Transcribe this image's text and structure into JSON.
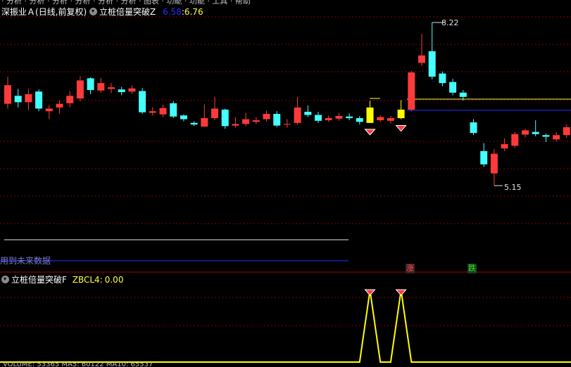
{
  "main_panel": {
    "stock_name": "深振业Ａ",
    "period": "(日线,前复权)",
    "indicator": "立桩倍量突破Z",
    "value1": "6.58",
    "separator": ":",
    "value2": "6.76",
    "value1_color": "#2b2bff",
    "value2_color": "#ffff4b",
    "high_label": "8.22",
    "low_label": "5.15",
    "future_data_warning": "用到未来数据",
    "tag_up": "涨",
    "tag_down": "跌"
  },
  "sub_panel": {
    "indicator": "立桩倍量突破F",
    "field": "ZBCL4",
    "separator": ":",
    "value": "0.00",
    "field_color": "#ffff4b"
  },
  "colors": {
    "up": "#ff3a3a",
    "down": "#44ffff",
    "signal": "#ffff00",
    "grid": "#8b0000",
    "panel_border": "#aa0000"
  },
  "chart_data": {
    "type": "candlestick",
    "price_high": 8.22,
    "price_low": 5.15,
    "candles": [
      {
        "o": 6.69,
        "c": 7.04,
        "h": 7.2,
        "l": 6.6
      },
      {
        "o": 6.84,
        "c": 6.72,
        "h": 6.97,
        "l": 6.62
      },
      {
        "o": 6.72,
        "c": 6.87,
        "h": 6.97,
        "l": 6.57
      },
      {
        "o": 6.92,
        "c": 6.6,
        "h": 6.96,
        "l": 6.55
      },
      {
        "o": 6.55,
        "c": 6.6,
        "h": 6.66,
        "l": 6.4
      },
      {
        "o": 6.62,
        "c": 6.69,
        "h": 6.75,
        "l": 6.5
      },
      {
        "o": 6.7,
        "c": 6.84,
        "h": 6.93,
        "l": 6.62
      },
      {
        "o": 6.79,
        "c": 7.13,
        "h": 7.21,
        "l": 6.74
      },
      {
        "o": 7.17,
        "c": 6.95,
        "h": 7.19,
        "l": 6.87
      },
      {
        "o": 6.94,
        "c": 7.08,
        "h": 7.18,
        "l": 6.9
      },
      {
        "o": 6.97,
        "c": 7.0,
        "h": 7.08,
        "l": 6.89
      },
      {
        "o": 6.96,
        "c": 6.91,
        "h": 7.01,
        "l": 6.85
      },
      {
        "o": 6.92,
        "c": 6.98,
        "h": 7.04,
        "l": 6.87
      },
      {
        "o": 6.93,
        "c": 6.53,
        "h": 6.99,
        "l": 6.5
      },
      {
        "o": 6.52,
        "c": 6.55,
        "h": 6.63,
        "l": 6.47
      },
      {
        "o": 6.49,
        "c": 6.61,
        "h": 6.67,
        "l": 6.44
      },
      {
        "o": 6.7,
        "c": 6.45,
        "h": 6.74,
        "l": 6.42
      },
      {
        "o": 6.47,
        "c": 6.4,
        "h": 6.49,
        "l": 6.36
      },
      {
        "o": 6.33,
        "c": 6.3,
        "h": 6.36,
        "l": 6.27
      },
      {
        "o": 6.26,
        "c": 6.42,
        "h": 6.68,
        "l": 6.26
      },
      {
        "o": 6.42,
        "c": 6.6,
        "h": 6.82,
        "l": 6.38
      },
      {
        "o": 6.58,
        "c": 6.27,
        "h": 6.6,
        "l": 6.22
      },
      {
        "o": 6.28,
        "c": 6.31,
        "h": 6.44,
        "l": 6.24
      },
      {
        "o": 6.31,
        "c": 6.4,
        "h": 6.52,
        "l": 6.27
      },
      {
        "o": 6.35,
        "c": 6.38,
        "h": 6.44,
        "l": 6.31
      },
      {
        "o": 6.4,
        "c": 6.5,
        "h": 6.56,
        "l": 6.36
      },
      {
        "o": 6.5,
        "c": 6.28,
        "h": 6.55,
        "l": 6.25
      },
      {
        "o": 6.3,
        "c": 6.31,
        "h": 6.4,
        "l": 6.24
      },
      {
        "o": 6.33,
        "c": 6.62,
        "h": 6.82,
        "l": 6.3
      },
      {
        "o": 6.54,
        "c": 6.48,
        "h": 6.66,
        "l": 6.44
      },
      {
        "o": 6.48,
        "c": 6.37,
        "h": 6.54,
        "l": 6.33
      },
      {
        "o": 6.38,
        "c": 6.42,
        "h": 6.47,
        "l": 6.35
      },
      {
        "o": 6.41,
        "c": 6.46,
        "h": 6.52,
        "l": 6.37
      },
      {
        "o": 6.45,
        "c": 6.42,
        "h": 6.51,
        "l": 6.38
      },
      {
        "o": 6.42,
        "c": 6.35,
        "h": 6.46,
        "l": 6.3
      },
      {
        "o": 6.33,
        "c": 6.62,
        "h": 6.75,
        "l": 6.33,
        "sig": true
      },
      {
        "o": 6.38,
        "c": 6.44,
        "h": 6.48,
        "l": 6.35
      },
      {
        "o": 6.37,
        "c": 6.42,
        "h": 6.46,
        "l": 6.32
      },
      {
        "o": 6.42,
        "c": 6.58,
        "h": 6.76,
        "l": 6.4,
        "sig": true
      },
      {
        "o": 6.58,
        "c": 7.28,
        "h": 7.31,
        "l": 6.55
      },
      {
        "o": 7.46,
        "c": 7.6,
        "h": 8.0,
        "l": 7.4
      },
      {
        "o": 7.68,
        "c": 7.2,
        "h": 8.22,
        "l": 7.15
      },
      {
        "o": 7.26,
        "c": 7.08,
        "h": 7.3,
        "l": 7.02
      },
      {
        "o": 7.1,
        "c": 6.9,
        "h": 7.16,
        "l": 6.85
      },
      {
        "o": 6.9,
        "c": 6.82,
        "h": 6.95,
        "l": 6.75
      },
      {
        "o": 6.34,
        "c": 6.14,
        "h": 6.4,
        "l": 6.1
      },
      {
        "o": 5.8,
        "c": 5.55,
        "h": 5.95,
        "l": 5.5
      },
      {
        "o": 5.38,
        "c": 5.75,
        "h": 5.84,
        "l": 5.15
      },
      {
        "o": 5.85,
        "c": 5.93,
        "h": 6.04,
        "l": 5.8
      },
      {
        "o": 5.9,
        "c": 6.12,
        "h": 6.16,
        "l": 5.86
      },
      {
        "o": 6.11,
        "c": 6.19,
        "h": 6.22,
        "l": 6.06
      },
      {
        "o": 6.16,
        "c": 6.12,
        "h": 6.38,
        "l": 6.08
      },
      {
        "o": 6.1,
        "c": 6.07,
        "h": 6.13,
        "l": 5.97
      },
      {
        "o": 6.02,
        "c": 6.1,
        "h": 6.16,
        "l": 5.98
      },
      {
        "o": 6.1,
        "c": 6.25,
        "h": 6.3,
        "l": 6.05
      }
    ],
    "sub_series": [
      0,
      0,
      0,
      0,
      0,
      0,
      0,
      0,
      0,
      0,
      0,
      0,
      0,
      0,
      0,
      0,
      0,
      0,
      0,
      0,
      0,
      0,
      0,
      0,
      0,
      0,
      0,
      0,
      0,
      0,
      0,
      0,
      0,
      0,
      0,
      1,
      0,
      0,
      1,
      0,
      0,
      0,
      0,
      0,
      0,
      0,
      0,
      0,
      0,
      0,
      0,
      0,
      0,
      0,
      0
    ]
  }
}
